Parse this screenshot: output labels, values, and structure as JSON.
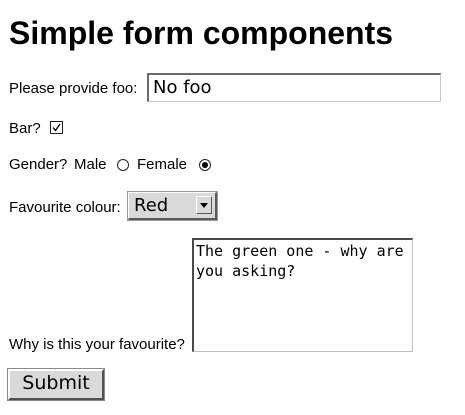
{
  "page": {
    "title": "Simple form components"
  },
  "form": {
    "foo": {
      "label": "Please provide foo:",
      "value": "No foo"
    },
    "bar": {
      "label": "Bar?",
      "checked": true
    },
    "gender": {
      "label": "Gender?",
      "options": [
        {
          "label": "Male",
          "selected": false
        },
        {
          "label": "Female",
          "selected": true
        }
      ]
    },
    "colour": {
      "label": "Favourite colour:",
      "selected": "Red"
    },
    "reason": {
      "label": "Why is this your favourite?",
      "value": "The green one - why are you asking?"
    },
    "submit_label": "Submit"
  },
  "colors": {
    "background": "#ffffff",
    "control_face": "#d9d9d9",
    "text": "#000000"
  }
}
